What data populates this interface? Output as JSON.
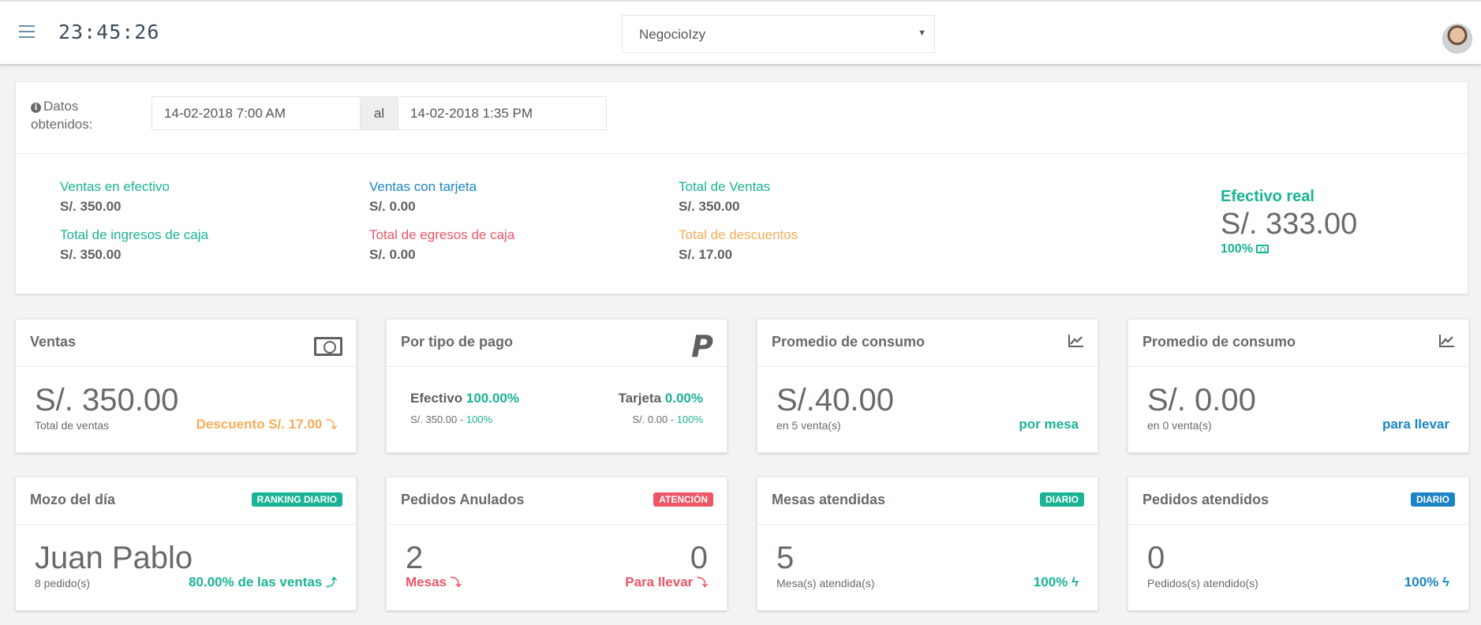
{
  "topbar": {
    "clock": "23:45:26",
    "business_select": "NegocioIzy"
  },
  "summary": {
    "datos_label": "Datos obtenidos:",
    "date_from": "14-02-2018 7:00 AM",
    "date_sep": "al",
    "date_to": "14-02-2018 1:35 PM",
    "stats": {
      "ventas_efectivo_label": "Ventas en efectivo",
      "ventas_efectivo_value": "S/. 350.00",
      "ingresos_caja_label": "Total de ingresos de caja",
      "ingresos_caja_value": "S/. 350.00",
      "ventas_tarjeta_label": "Ventas con tarjeta",
      "ventas_tarjeta_value": "S/. 0.00",
      "egresos_caja_label": "Total de egresos de caja",
      "egresos_caja_value": "S/. 0.00",
      "total_ventas_label": "Total de Ventas",
      "total_ventas_value": "S/. 350.00",
      "total_descuentos_label": "Total de descuentos",
      "total_descuentos_value": "S/. 17.00"
    },
    "efectivo_real": {
      "title": "Efectivo real",
      "value": "S/. 333.00",
      "percent": "100%"
    }
  },
  "widgets": {
    "ventas": {
      "title": "Ventas",
      "amount": "S/. 350.00",
      "caption": "Total de ventas",
      "discount": "Descuento S/. 17.00"
    },
    "tipo_pago": {
      "title": "Por tipo de pago",
      "efectivo_label": "Efectivo",
      "efectivo_pct": "100.00%",
      "efectivo_amount": "S/. 350.00 -",
      "efectivo_sub_pct": "100%",
      "tarjeta_label": "Tarjeta",
      "tarjeta_pct": "0.00%",
      "tarjeta_amount": "S/. 0.00 -",
      "tarjeta_sub_pct": "100%"
    },
    "consumo_mesa": {
      "title": "Promedio de consumo",
      "amount": "S/.40.00",
      "caption": "en 5 venta(s)",
      "tag": "por mesa"
    },
    "consumo_llevar": {
      "title": "Promedio de consumo",
      "amount": "S/. 0.00",
      "caption": "en 0 venta(s)",
      "tag": "para llevar"
    },
    "mozo": {
      "title": "Mozo del día",
      "badge": "RANKING DIARIO",
      "name": "Juan Pablo",
      "caption": "8 pedido(s)",
      "share": "80.00% de las ventas"
    },
    "anulados": {
      "title": "Pedidos Anulados",
      "badge": "ATENCIÓN",
      "mesas_count": "2",
      "llevar_count": "0",
      "mesas_label": "Mesas",
      "llevar_label": "Para llevar"
    },
    "mesas": {
      "title": "Mesas atendidas",
      "badge": "DIARIO",
      "count": "5",
      "caption": "Mesa(s) atendida(s)",
      "percent": "100%"
    },
    "pedidos": {
      "title": "Pedidos atendidos",
      "badge": "DIARIO",
      "count": "0",
      "caption": "Pedidos(s) atendido(s)",
      "percent": "100%"
    }
  },
  "colors": {
    "green": "#1ab394",
    "blue": "#1c84c6",
    "red": "#ed5565",
    "orange": "#f8ac59"
  }
}
